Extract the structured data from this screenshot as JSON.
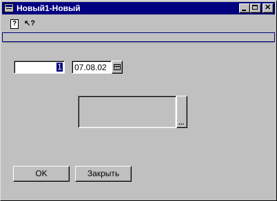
{
  "window": {
    "title": "Новый1-Новый"
  },
  "toolbar": {
    "help_label": "?",
    "whatis_label": "↖?"
  },
  "form": {
    "number_value": "1",
    "date_value": "07.08.02",
    "ellipsis_label": "..."
  },
  "buttons": {
    "ok": "OK",
    "close": "Закрыть"
  }
}
